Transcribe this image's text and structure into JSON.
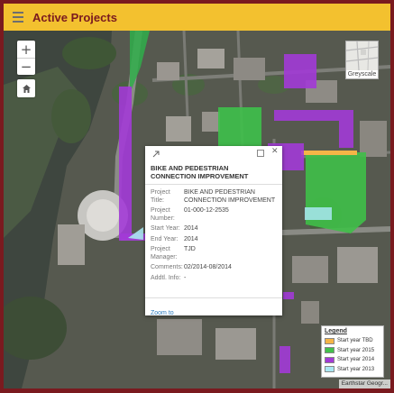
{
  "header": {
    "title": "Active Projects",
    "menu_icon": "hamburger-menu-icon"
  },
  "map_controls": {
    "zoom_in": "+",
    "zoom_out": "−",
    "home_icon": "home-icon",
    "basemap_label": "Greyscale"
  },
  "popup": {
    "title": "BIKE AND PEDESTRIAN CONNECTION IMPROVEMENT",
    "fields": [
      {
        "key": "Project Title:",
        "value": "BIKE AND PEDESTRIAN CONNECTION IMPROVEMENT"
      },
      {
        "key": "Project Number:",
        "value": "01-000-12-2535"
      },
      {
        "key": "Start Year:",
        "value": "2014"
      },
      {
        "key": "End Year:",
        "value": "2014"
      },
      {
        "key": "Project Manager:",
        "value": "TJD"
      },
      {
        "key": "Comments:",
        "value": "02/2014-08/2014"
      },
      {
        "key": "Addtl. Info:",
        "value": "-"
      }
    ],
    "zoom_link": "Zoom to"
  },
  "legend": {
    "title": "Legend",
    "items": [
      {
        "label": "Start year TBD",
        "color": "#f5b547"
      },
      {
        "label": "Start year 2015",
        "color": "#43c04c"
      },
      {
        "label": "Start year 2014",
        "color": "#a23ad6"
      },
      {
        "label": "Start year 2013",
        "color": "#a9e7f2"
      }
    ]
  },
  "attribution": "Earthstar Geogr..."
}
